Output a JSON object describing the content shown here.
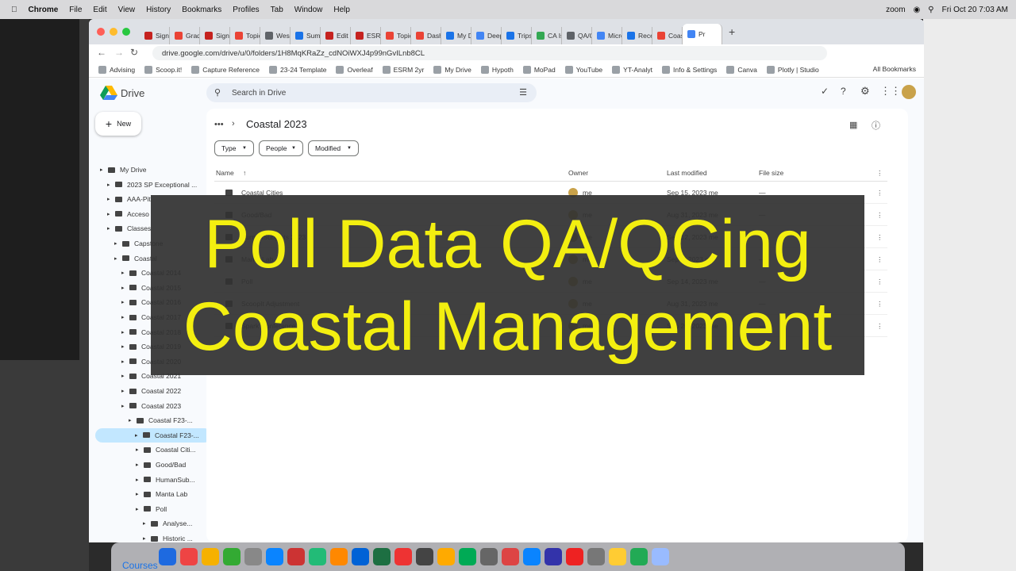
{
  "menubar": {
    "app": "Chrome",
    "items": [
      "File",
      "Edit",
      "View",
      "History",
      "Bookmarks",
      "Profiles",
      "Tab",
      "Window",
      "Help"
    ],
    "zoom": "zoom",
    "clock": "Fri Oct 20  7:03 AM"
  },
  "tabs": [
    "Sign I",
    "Grade",
    "Sign I",
    "Topic",
    "Weste",
    "Summ",
    "Edit P",
    "ESRM",
    "Topic",
    "Dashb",
    "My Dr",
    "Deep",
    "Trips/",
    "CA Isl",
    "QA/Q",
    "Micro",
    "Recei",
    "Coast",
    "Pr"
  ],
  "tab_colors": [
    "#c5221f",
    "#ea4335",
    "#c5221f",
    "#ea4335",
    "#5f6368",
    "#1a73e8",
    "#c5221f",
    "#c5221f",
    "#ea4335",
    "#ea4335",
    "#1a73e8",
    "#4285f4",
    "#1a73e8",
    "#34a853",
    "#5f6368",
    "#4285f4",
    "#1a73e8",
    "#ea4335",
    "#4285f4"
  ],
  "url": "drive.google.com/drive/u/0/folders/1H8MqKRaZz_cdNOiWXJ4p99nGvILnb8CL",
  "bookmarks": [
    "Advising",
    "Scoop.it!",
    "Capture Reference",
    "23-24 Template",
    "Overleaf",
    "ESRM 2yr",
    "My Drive",
    "Hypoth",
    "MoPad",
    "YouTube",
    "YT-Analyt",
    "Info & Settings",
    "Canva",
    "Plotly | Studio"
  ],
  "all_bookmarks": "All Bookmarks",
  "drive": {
    "logo": "Drive",
    "search_placeholder": "Search in Drive",
    "new_label": "New",
    "tree": [
      {
        "label": "My Drive",
        "indent": 0
      },
      {
        "label": "2023 SP Exceptional ...",
        "indent": 1
      },
      {
        "label": "AAA-Pit",
        "indent": 1
      },
      {
        "label": "Acceso",
        "indent": 1
      },
      {
        "label": "Classes",
        "indent": 1
      },
      {
        "label": "Capstone",
        "indent": 2
      },
      {
        "label": "Coastal",
        "indent": 2
      },
      {
        "label": "Coastal 2014",
        "indent": 3
      },
      {
        "label": "Coastal 2015",
        "indent": 3
      },
      {
        "label": "Coastal 2016",
        "indent": 3
      },
      {
        "label": "Coastal 2017",
        "indent": 3
      },
      {
        "label": "Coastal 2018",
        "indent": 3
      },
      {
        "label": "Coastal 2019",
        "indent": 3
      },
      {
        "label": "Coastal 2020",
        "indent": 3
      },
      {
        "label": "Coastal 2021",
        "indent": 3
      },
      {
        "label": "Coastal 2022",
        "indent": 3
      },
      {
        "label": "Coastal 2023",
        "indent": 3
      },
      {
        "label": "Coastal F23-...",
        "indent": 4
      },
      {
        "label": "Coastal F23-...",
        "indent": 4,
        "selected": true
      },
      {
        "label": "Coastal Citi...",
        "indent": 5
      },
      {
        "label": "Good/Bad",
        "indent": 5
      },
      {
        "label": "HumanSub...",
        "indent": 5
      },
      {
        "label": "Manta Lab",
        "indent": 5
      },
      {
        "label": "Poll",
        "indent": 5
      },
      {
        "label": "Analyse...",
        "indent": 6
      },
      {
        "label": "Historic ...",
        "indent": 6
      },
      {
        "label": "QA/QC",
        "indent": 6
      }
    ],
    "breadcrumb": "Coastal 2023",
    "filters": [
      "Type",
      "People",
      "Modified"
    ],
    "columns": {
      "name": "Name",
      "owner": "Owner",
      "modified": "Last modified",
      "size": "File size"
    },
    "rows": [
      {
        "name": "Coastal Cities",
        "owner": "me",
        "modified": "Sep 15, 2023 me",
        "size": "—"
      },
      {
        "name": "Good/Bad",
        "owner": "me",
        "modified": "Aug 31, 2023 me",
        "size": "—"
      },
      {
        "name": "HumanSubjects 2023",
        "owner": "me",
        "modified": "Sep 12, 2023 me",
        "size": "—"
      },
      {
        "name": "Manta Lab",
        "owner": "me",
        "modified": "Sep 8, 2023 me",
        "size": "—"
      },
      {
        "name": "Poll",
        "owner": "me",
        "modified": "Sep 14, 2023 me",
        "size": "—"
      },
      {
        "name": "ScoopIt Adjustment",
        "owner": "me",
        "modified": "Aug 31, 2023 me",
        "size": "—"
      },
      {
        "name": "Spark Conference",
        "owner": "me",
        "modified": "Sep 20, 2023 me",
        "size": "—"
      }
    ]
  },
  "overlay": {
    "line1": "Poll Data QA/QCing",
    "line2": "Coastal Management"
  },
  "dock": {
    "bottom_label": "Courses"
  }
}
